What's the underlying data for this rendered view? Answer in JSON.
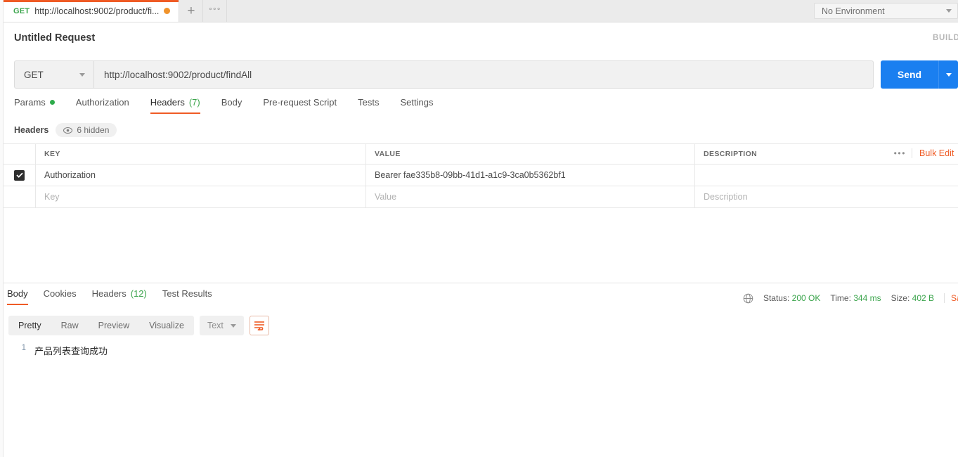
{
  "tabbar": {
    "request_tab": {
      "method": "GET",
      "url": "http://localhost:9002/product/fi...",
      "unsaved": true
    },
    "new_tab_label": "+",
    "more_label": "°°°",
    "environment": {
      "selected": "No Environment"
    }
  },
  "request": {
    "title": "Untitled Request",
    "build_label": "BUILD",
    "method": "GET",
    "url": "http://localhost:9002/product/findAll",
    "send_label": "Send",
    "tabs": [
      {
        "label": "Params",
        "dot": true,
        "active": false
      },
      {
        "label": "Authorization",
        "active": false
      },
      {
        "label": "Headers",
        "count": "(7)",
        "active": true
      },
      {
        "label": "Body",
        "active": false
      },
      {
        "label": "Pre-request Script",
        "active": false
      },
      {
        "label": "Tests",
        "active": false
      },
      {
        "label": "Settings",
        "active": false
      }
    ],
    "headers_section": {
      "label": "Headers",
      "hidden_pill": "6 hidden",
      "columns": {
        "key": "KEY",
        "value": "VALUE",
        "description": "DESCRIPTION"
      },
      "bulk_edit_label": "Bulk Edit",
      "rows": [
        {
          "checked": true,
          "key": "Authorization",
          "value": "Bearer fae335b8-09bb-41d1-a1c9-3ca0b5362bf1",
          "description": ""
        }
      ],
      "placeholder_row": {
        "key": "Key",
        "value": "Value",
        "description": "Description"
      }
    }
  },
  "response": {
    "tabs": [
      {
        "label": "Body",
        "active": true
      },
      {
        "label": "Cookies",
        "active": false
      },
      {
        "label": "Headers",
        "count": "(12)",
        "active": false
      },
      {
        "label": "Test Results",
        "active": false
      }
    ],
    "meta": {
      "status_label": "Status:",
      "status_value": "200 OK",
      "time_label": "Time:",
      "time_value": "344 ms",
      "size_label": "Size:",
      "size_value": "402 B",
      "save_label": "Save Response"
    },
    "view_modes": [
      {
        "label": "Pretty",
        "active": true
      },
      {
        "label": "Raw",
        "active": false
      },
      {
        "label": "Preview",
        "active": false
      },
      {
        "label": "Visualize",
        "active": false
      }
    ],
    "format": "Text",
    "body": {
      "line_number": "1",
      "text": "产品列表查询成功"
    }
  },
  "colors": {
    "accent": "#ef5b25",
    "send": "#1a7ff0",
    "success": "#3aa44b"
  }
}
